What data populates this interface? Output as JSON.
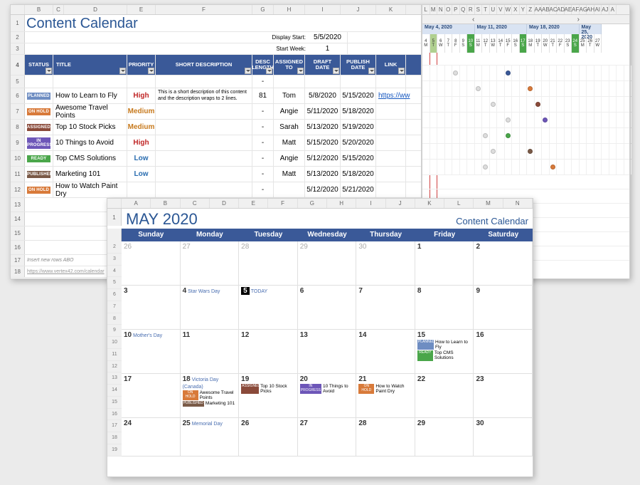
{
  "top": {
    "col_letters": [
      "B",
      "C",
      "D",
      "E",
      "F",
      "G",
      "H",
      "I",
      "J",
      "K",
      "L",
      "M",
      "N",
      "O",
      "P",
      "Q",
      "R",
      "S",
      "T",
      "U",
      "V",
      "W",
      "X",
      "Y",
      "Z",
      "AA",
      "AB",
      "AC",
      "AD",
      "AE",
      "AF",
      "AG",
      "AH",
      "AI",
      "AJ",
      "A"
    ],
    "title": "Content Calendar",
    "display_start_label": "Display Start:",
    "display_start_value": "5/5/2020",
    "start_week_label": "Start Week:",
    "start_week_value": "1",
    "headers": {
      "status": "STATUS",
      "title": "TITLE",
      "priority": "PRIORITY",
      "desc": "SHORT DESCRIPTION",
      "len": "DESC LENGTH",
      "assigned": "ASSIGNED TO",
      "draft": "DRAFT DATE",
      "publish": "PUBLISH DATE",
      "link": "LINK"
    },
    "rows": [
      {
        "rn": "6",
        "status": "PLANNED",
        "status_cls": "planned",
        "color": "#3a5998",
        "title": "How to Learn to Fly",
        "priority": "High",
        "pri_cls": "pri-high",
        "desc": "This is a short description of this content and the description wraps to 2 lines.",
        "len": "81",
        "assigned": "Tom",
        "draft": "5/8/2020",
        "publish": "5/15/2020",
        "link": "https://ww",
        "draft_idx": 4,
        "pub_idx": 11
      },
      {
        "rn": "7",
        "status": "ON HOLD",
        "status_cls": "onhold",
        "color": "#d87a3a",
        "title": "Awesome Travel Points",
        "priority": "Medium",
        "pri_cls": "pri-med",
        "desc": "",
        "len": "-",
        "assigned": "Angie",
        "draft": "5/11/2020",
        "publish": "5/18/2020",
        "link": "",
        "draft_idx": 7,
        "pub_idx": 14
      },
      {
        "rn": "8",
        "status": "ASSIGNED",
        "status_cls": "assigned",
        "color": "#8a4a3a",
        "title": "Top 10 Stock Picks",
        "priority": "Medium",
        "pri_cls": "pri-med",
        "desc": "",
        "len": "-",
        "assigned": "Sarah",
        "draft": "5/13/2020",
        "publish": "5/19/2020",
        "link": "",
        "draft_idx": 9,
        "pub_idx": 15
      },
      {
        "rn": "9",
        "status": "IN PROGRESS",
        "status_cls": "inprog",
        "color": "#6d56b8",
        "title": "10 Things to Avoid",
        "priority": "High",
        "pri_cls": "pri-high",
        "desc": "",
        "len": "-",
        "assigned": "Matt",
        "draft": "5/15/2020",
        "publish": "5/20/2020",
        "link": "",
        "draft_idx": 11,
        "pub_idx": 16
      },
      {
        "rn": "10",
        "status": "READY",
        "status_cls": "ready",
        "color": "#4aa64a",
        "title": "Top CMS Solutions",
        "priority": "Low",
        "pri_cls": "pri-low",
        "desc": "",
        "len": "-",
        "assigned": "Angie",
        "draft": "5/12/2020",
        "publish": "5/15/2020",
        "link": "",
        "draft_idx": 8,
        "pub_idx": 11
      },
      {
        "rn": "11",
        "status": "PUBLISHED",
        "status_cls": "published",
        "color": "#7a5a47",
        "title": "Marketing 101",
        "priority": "Low",
        "pri_cls": "pri-low",
        "desc": "",
        "len": "-",
        "assigned": "Matt",
        "draft": "5/13/2020",
        "publish": "5/18/2020",
        "link": "",
        "draft_idx": 9,
        "pub_idx": 14
      },
      {
        "rn": "12",
        "status": "ON HOLD",
        "status_cls": "onhold",
        "color": "#d87a3a",
        "title": "How to Watch Paint Dry",
        "priority": "",
        "pri_cls": "",
        "desc": "",
        "len": "-",
        "assigned": "",
        "draft": "5/12/2020",
        "publish": "5/21/2020",
        "link": "",
        "draft_idx": 8,
        "pub_idx": 17
      }
    ],
    "insert_note": "Insert new rows ABO",
    "footer_link": "https://www.vertex42.com/calendar",
    "gantt": {
      "weeks": [
        {
          "label": "May 4, 2020"
        },
        {
          "label": "May 11, 2020"
        },
        {
          "label": "May 18, 2020"
        },
        {
          "label": "May 25, 2020"
        }
      ],
      "daynums": [
        "4",
        "5",
        "6",
        "7",
        "8",
        "9",
        "10",
        "11",
        "12",
        "13",
        "14",
        "15",
        "16",
        "17",
        "18",
        "19",
        "20",
        "21",
        "22",
        "23",
        "24",
        "25",
        "26",
        "27"
      ],
      "dow": [
        "M",
        "T",
        "W",
        "T",
        "F",
        "S",
        "S",
        "M",
        "T",
        "W",
        "T",
        "F",
        "S",
        "S",
        "M",
        "T",
        "W",
        "T",
        "F",
        "S",
        "S",
        "M",
        "T",
        "W"
      ]
    }
  },
  "cal": {
    "col_letters": [
      "",
      "A",
      "B",
      "C",
      "D",
      "E",
      "F",
      "G",
      "H",
      "I",
      "J",
      "K",
      "L",
      "M",
      "N"
    ],
    "month": "MAY 2020",
    "subtitle": "Content Calendar",
    "dow": [
      "Sunday",
      "Monday",
      "Tuesday",
      "Wednesday",
      "Thursday",
      "Friday",
      "Saturday"
    ],
    "row_nums": [
      "2",
      "3",
      "4",
      "5",
      "6",
      "7",
      "8",
      "9",
      "10",
      "11",
      "12",
      "13",
      "14",
      "15",
      "16",
      "17",
      "18",
      "19"
    ],
    "weeks": [
      [
        {
          "n": "26",
          "dim": true
        },
        {
          "n": "27",
          "dim": true
        },
        {
          "n": "28",
          "dim": true
        },
        {
          "n": "29",
          "dim": true
        },
        {
          "n": "30",
          "dim": true
        },
        {
          "n": "1"
        },
        {
          "n": "2"
        }
      ],
      [
        {
          "n": "3"
        },
        {
          "n": "4",
          "holiday": "Star Wars Day"
        },
        {
          "n": "5",
          "today": true,
          "holiday": "TODAY"
        },
        {
          "n": "6"
        },
        {
          "n": "7"
        },
        {
          "n": "8"
        },
        {
          "n": "9"
        }
      ],
      [
        {
          "n": "10",
          "holiday": "Mother's Day"
        },
        {
          "n": "11"
        },
        {
          "n": "12"
        },
        {
          "n": "13"
        },
        {
          "n": "14"
        },
        {
          "n": "15",
          "events": [
            {
              "tag": "PLANNED",
              "cls": "planned",
              "txt": "How to Learn to Fly"
            },
            {
              "tag": "READY",
              "cls": "ready",
              "txt": "Top CMS Solutions"
            }
          ]
        },
        {
          "n": "16"
        }
      ],
      [
        {
          "n": "17"
        },
        {
          "n": "18",
          "holiday": "Victoria Day (Canada)",
          "events": [
            {
              "tag": "ON HOLD",
              "cls": "onhold",
              "txt": "Awesome Travel Points"
            },
            {
              "tag": "PUBLISHED",
              "cls": "published",
              "txt": "Marketing 101"
            }
          ]
        },
        {
          "n": "19",
          "events": [
            {
              "tag": "ASSIGNED",
              "cls": "assigned",
              "txt": "Top 10 Stock Picks"
            }
          ]
        },
        {
          "n": "20",
          "events": [
            {
              "tag": "IN PROGRESS",
              "cls": "inprog",
              "txt": "10 Things to Avoid"
            }
          ]
        },
        {
          "n": "21",
          "events": [
            {
              "tag": "ON HOLD",
              "cls": "onhold",
              "txt": "How to Watch Paint Dry"
            }
          ]
        },
        {
          "n": "22"
        },
        {
          "n": "23"
        }
      ],
      [
        {
          "n": "24"
        },
        {
          "n": "25",
          "holiday": "Memorial Day"
        },
        {
          "n": "26"
        },
        {
          "n": "27"
        },
        {
          "n": "28"
        },
        {
          "n": "29"
        },
        {
          "n": "30"
        }
      ]
    ]
  }
}
